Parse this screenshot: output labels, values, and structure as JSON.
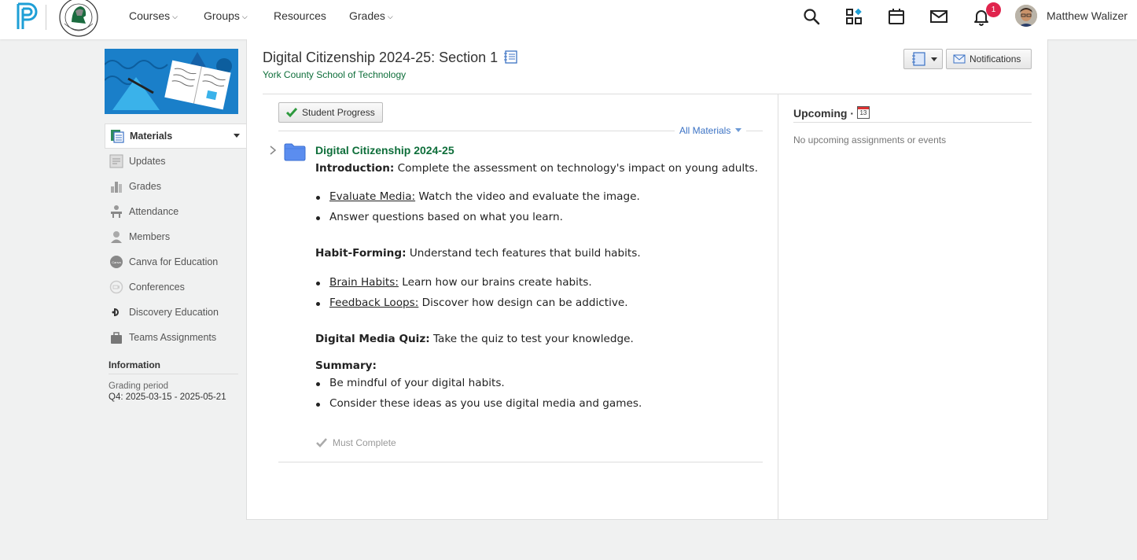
{
  "nav": {
    "courses": "Courses",
    "groups": "Groups",
    "resources": "Resources",
    "grades": "Grades",
    "notification_count": "1",
    "user_name": "Matthew Walizer"
  },
  "sidebar": {
    "items": [
      {
        "label": "Materials",
        "icon": "materials-icon"
      },
      {
        "label": "Updates",
        "icon": "updates-icon"
      },
      {
        "label": "Grades",
        "icon": "grades-icon"
      },
      {
        "label": "Attendance",
        "icon": "attendance-icon"
      },
      {
        "label": "Members",
        "icon": "members-icon"
      },
      {
        "label": "Canva for Education",
        "icon": "canva-icon"
      },
      {
        "label": "Conferences",
        "icon": "conferences-icon"
      },
      {
        "label": "Discovery Education",
        "icon": "discovery-icon"
      },
      {
        "label": "Teams Assignments",
        "icon": "teams-icon"
      }
    ],
    "info_heading": "Information",
    "grading_label": "Grading period",
    "grading_value": "Q4: 2025-03-15 - 2025-05-21"
  },
  "header": {
    "course_title": "Digital Citizenship 2024-25: Section 1",
    "school": "York County School of Technology",
    "notifications_button": "Notifications"
  },
  "materials": {
    "student_progress_button": "Student Progress",
    "filter_label": "All Materials",
    "folder_title": "Digital Citizenship 2024-25",
    "intro_label": "Introduction:",
    "intro_text": " Complete the assessment on technology's impact on young adults.",
    "b1_link": "Evaluate Media:",
    "b1_text": " Watch the video and evaluate the image.",
    "b2_text": "Answer questions based on what you learn.",
    "habit_label": "Habit-Forming:",
    "habit_text": " Understand tech features that build habits.",
    "b3_link": "Brain Habits:",
    "b3_text": " Learn how our brains create habits.",
    "b4_link": "Feedback Loops:",
    "b4_text": " Discover how design can be addictive.",
    "quiz_label": "Digital Media Quiz:",
    "quiz_text": " Take the quiz to test your knowledge.",
    "summary_label": "Summary:",
    "b5_text": "Be mindful of your digital habits.",
    "b6_text": "Consider these ideas as you use digital media and games.",
    "must_complete": "Must Complete"
  },
  "upcoming": {
    "title": "Upcoming",
    "separator": "·",
    "calendar_day": "13",
    "empty_text": "No upcoming assignments or events"
  },
  "colors": {
    "accent_green": "#0e6e3a",
    "link_blue": "#3b72c4",
    "badge_red": "#e0244d",
    "folder_blue": "#5b8def"
  }
}
